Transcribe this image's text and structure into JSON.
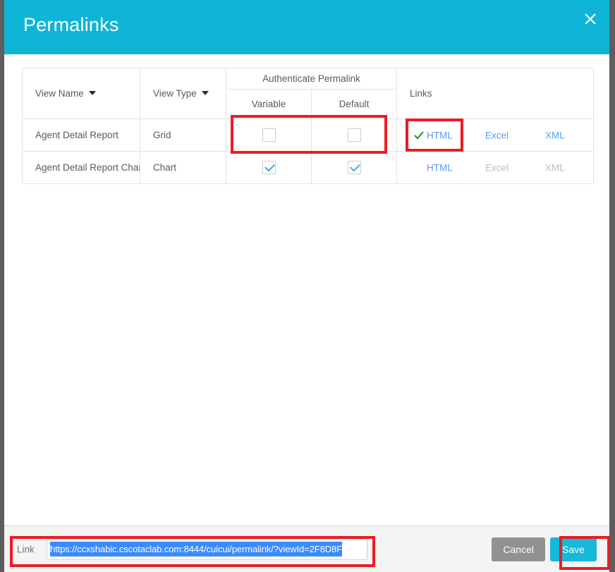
{
  "window": {
    "title": "Permalinks",
    "close_icon": "close-x-icon",
    "accent_color": "#0fb5d6",
    "annotation_color": "#ec1c24"
  },
  "table": {
    "headers": {
      "view_name": "View Name",
      "view_type": "View Type",
      "authenticate_permalink": "Authenticate Permalink",
      "variable": "Variable",
      "default": "Default",
      "links": "Links"
    },
    "sort_icon": "caret-down-icon",
    "rows": [
      {
        "view_name": "Agent Detail Report",
        "view_type": "Grid",
        "variable_checked": false,
        "default_checked": false,
        "selected_link": "HTML",
        "selected_icon": "green-check-icon",
        "links": [
          {
            "label": "HTML",
            "disabled": false
          },
          {
            "label": "Excel",
            "disabled": false
          },
          {
            "label": "XML",
            "disabled": false
          }
        ]
      },
      {
        "view_name": "Agent Detail Report Chart",
        "view_type": "Chart",
        "variable_checked": true,
        "default_checked": true,
        "selected_link": "",
        "selected_icon": "",
        "links": [
          {
            "label": "HTML",
            "disabled": false
          },
          {
            "label": "Excel",
            "disabled": true
          },
          {
            "label": "XML",
            "disabled": true
          }
        ]
      }
    ]
  },
  "footer": {
    "link_label": "Link",
    "link_value": "https://ccxshabic.cscotaclab.com:8444/cuicui/permalink/?viewId=2F8D8F",
    "link_placeholder": "",
    "cancel_label": "Cancel",
    "save_label": "Save"
  }
}
